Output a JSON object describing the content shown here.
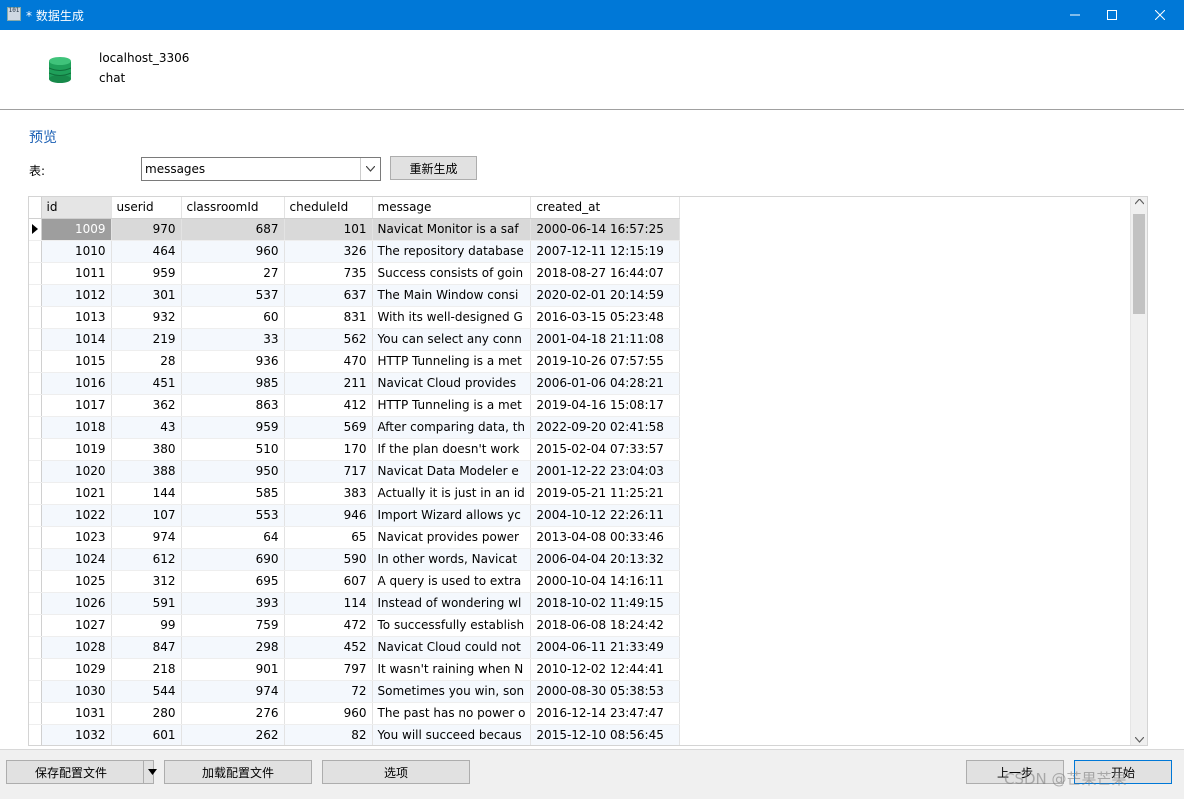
{
  "window": {
    "title": "* 数据生成",
    "app_icon_text": "101"
  },
  "connection": {
    "name": "localhost_3306",
    "database": "chat"
  },
  "preview": {
    "section_title": "预览",
    "table_label": "表:",
    "table_value": "messages",
    "regenerate_label": "重新生成"
  },
  "grid": {
    "columns": [
      "id",
      "userid",
      "classroomId",
      "cheduleId",
      "message",
      "created_at"
    ],
    "rows": [
      [
        "1009",
        "970",
        "687",
        "101",
        "Navicat Monitor is a saf",
        "2000-06-14 16:57:25"
      ],
      [
        "1010",
        "464",
        "960",
        "326",
        "The repository database",
        "2007-12-11 12:15:19"
      ],
      [
        "1011",
        "959",
        "27",
        "735",
        "Success consists of goin",
        "2018-08-27 16:44:07"
      ],
      [
        "1012",
        "301",
        "537",
        "637",
        "The Main Window consi",
        "2020-02-01 20:14:59"
      ],
      [
        "1013",
        "932",
        "60",
        "831",
        "With its well-designed G",
        "2016-03-15 05:23:48"
      ],
      [
        "1014",
        "219",
        "33",
        "562",
        "You can select any conn",
        "2001-04-18 21:11:08"
      ],
      [
        "1015",
        "28",
        "936",
        "470",
        "HTTP Tunneling is a met",
        "2019-10-26 07:57:55"
      ],
      [
        "1016",
        "451",
        "985",
        "211",
        "Navicat Cloud provides",
        "2006-01-06 04:28:21"
      ],
      [
        "1017",
        "362",
        "863",
        "412",
        "HTTP Tunneling is a met",
        "2019-04-16 15:08:17"
      ],
      [
        "1018",
        "43",
        "959",
        "569",
        "After comparing data, th",
        "2022-09-20 02:41:58"
      ],
      [
        "1019",
        "380",
        "510",
        "170",
        "If the plan doesn't work",
        "2015-02-04 07:33:57"
      ],
      [
        "1020",
        "388",
        "950",
        "717",
        "Navicat Data Modeler e",
        "2001-12-22 23:04:03"
      ],
      [
        "1021",
        "144",
        "585",
        "383",
        "Actually it is just in an id",
        "2019-05-21 11:25:21"
      ],
      [
        "1022",
        "107",
        "553",
        "946",
        "Import Wizard allows yc",
        "2004-10-12 22:26:11"
      ],
      [
        "1023",
        "974",
        "64",
        "65",
        "Navicat provides power",
        "2013-04-08 00:33:46"
      ],
      [
        "1024",
        "612",
        "690",
        "590",
        "In other words, Navicat",
        "2006-04-04 20:13:32"
      ],
      [
        "1025",
        "312",
        "695",
        "607",
        "A query is used to extra",
        "2000-10-04 14:16:11"
      ],
      [
        "1026",
        "591",
        "393",
        "114",
        "Instead of wondering wl",
        "2018-10-02 11:49:15"
      ],
      [
        "1027",
        "99",
        "759",
        "472",
        "To successfully establish",
        "2018-06-08 18:24:42"
      ],
      [
        "1028",
        "847",
        "298",
        "452",
        "Navicat Cloud could not",
        "2004-06-11 21:33:49"
      ],
      [
        "1029",
        "218",
        "901",
        "797",
        "It wasn't raining when N",
        "2010-12-02 12:44:41"
      ],
      [
        "1030",
        "544",
        "974",
        "72",
        "Sometimes you win, son",
        "2000-08-30 05:38:53"
      ],
      [
        "1031",
        "280",
        "276",
        "960",
        "The past has no power o",
        "2016-12-14 23:47:47"
      ],
      [
        "1032",
        "601",
        "262",
        "82",
        "You will succeed becaus",
        "2015-12-10 08:56:45"
      ]
    ],
    "selected_row": 0
  },
  "bottom": {
    "save_config": "保存配置文件",
    "load_config": "加载配置文件",
    "options": "选项",
    "back": "上一步",
    "start": "开始"
  },
  "watermark": "CSDN @芒果芒果",
  "colors": {
    "titlebar": "#0078d7",
    "accent_text": "#1a5fb4",
    "db_icon": "#1fa05a"
  }
}
